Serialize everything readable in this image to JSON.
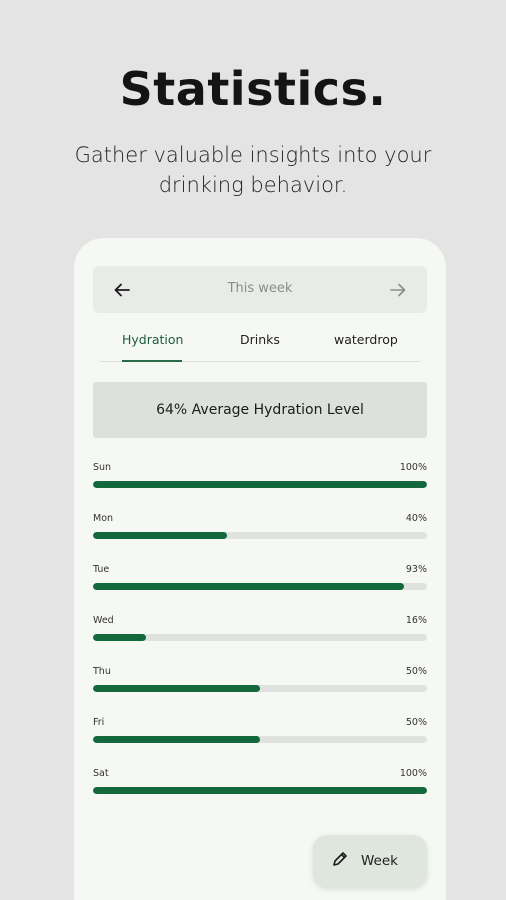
{
  "promo": {
    "headline": "Statistics.",
    "subline": "Gather valuable insights into your drinking behavior."
  },
  "nav": {
    "title": "This week",
    "prev_icon": "arrow-left-icon",
    "next_icon": "arrow-right-icon"
  },
  "tabs": [
    {
      "label": "Hydration",
      "active": true
    },
    {
      "label": "Drinks",
      "active": false
    },
    {
      "label": "waterdrop",
      "active": false
    }
  ],
  "summary": "64% Average Hydration Level",
  "days": [
    {
      "day": "Sun",
      "pct_label": "100%",
      "value": 100
    },
    {
      "day": "Mon",
      "pct_label": "40%",
      "value": 40
    },
    {
      "day": "Tue",
      "pct_label": "93%",
      "value": 93
    },
    {
      "day": "Wed",
      "pct_label": "16%",
      "value": 16
    },
    {
      "day": "Thu",
      "pct_label": "50%",
      "value": 50
    },
    {
      "day": "Fri",
      "pct_label": "50%",
      "value": 50
    },
    {
      "day": "Sat",
      "pct_label": "100%",
      "value": 100
    }
  ],
  "fab": {
    "label": "Week",
    "icon": "pencil-icon"
  },
  "colors": {
    "accent": "#13683c",
    "track": "#dfe2de",
    "background": "#e4e4e4",
    "card": "#f6f8f4"
  }
}
